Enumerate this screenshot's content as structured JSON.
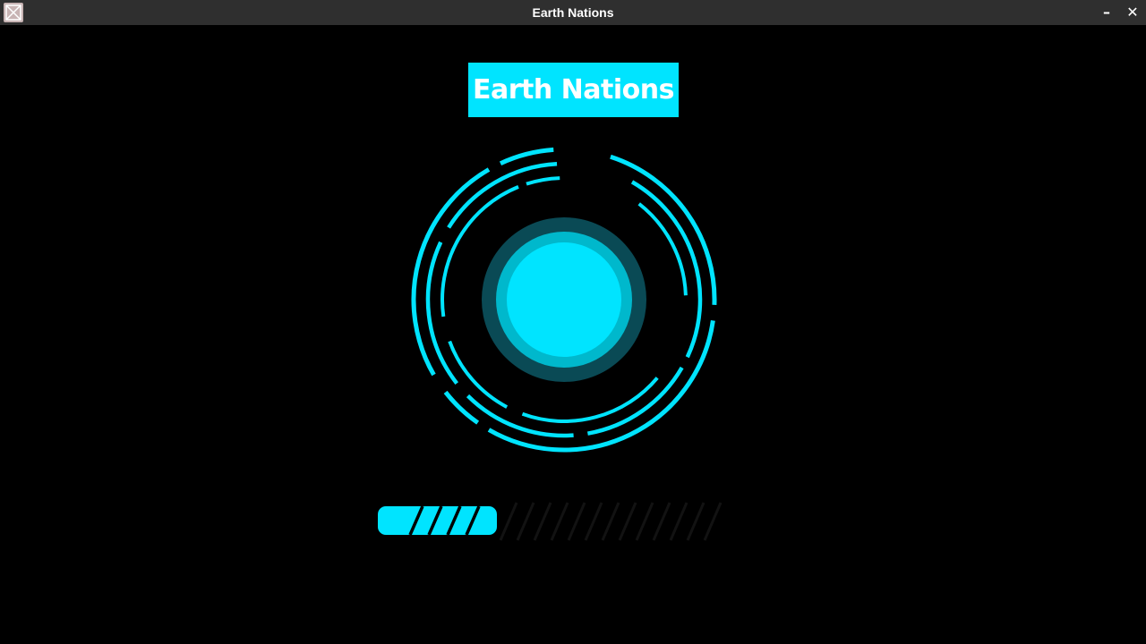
{
  "window": {
    "title": "Earth Nations",
    "app_icon": "app-icon",
    "minimize_glyph": "–",
    "close_glyph": "✕"
  },
  "splash": {
    "title": "Earth Nations"
  },
  "loader": {
    "icon": "circular-spinner",
    "accent_color": "#00e4ff"
  },
  "progress": {
    "value": 0.35,
    "segments_total": 10,
    "segments_filled": 4,
    "fill_color": "#00e4ff",
    "track_color": "#121212"
  }
}
